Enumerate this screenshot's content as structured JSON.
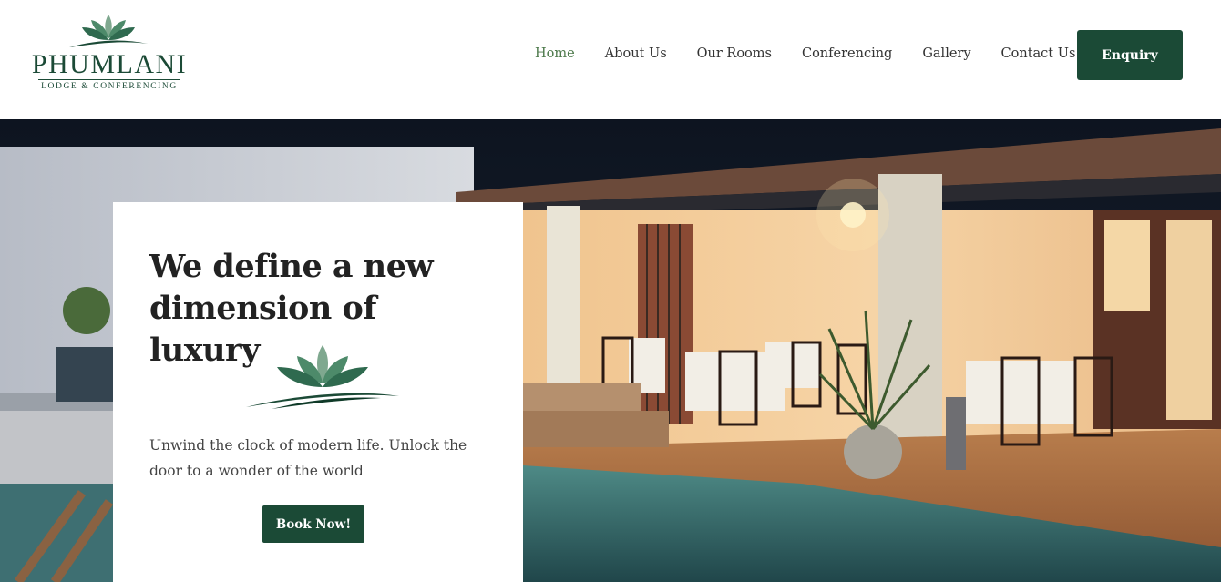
{
  "brand": {
    "name": "PHUMLANI",
    "tagline": "LODGE & CONFERENCING"
  },
  "nav": {
    "items": [
      {
        "label": "Home",
        "active": true
      },
      {
        "label": "About Us",
        "active": false
      },
      {
        "label": "Our Rooms",
        "active": false
      },
      {
        "label": "Conferencing",
        "active": false
      },
      {
        "label": "Gallery",
        "active": false
      },
      {
        "label": "Contact Us",
        "active": false
      }
    ],
    "enquiry_label": "Enquiry"
  },
  "hero": {
    "title": "We define a new dimension of luxury",
    "text": "Unwind the clock of modern life. Unlock the door to a wonder of the world",
    "cta_label": "Book Now!"
  },
  "colors": {
    "brand_green": "#1b4a36",
    "active_nav": "#4e7a4c",
    "lotus_light": "#7fa88f",
    "lotus_dark": "#2f6a4f"
  },
  "icons": [
    "lotus-logo-icon",
    "lotus-divider-icon"
  ]
}
